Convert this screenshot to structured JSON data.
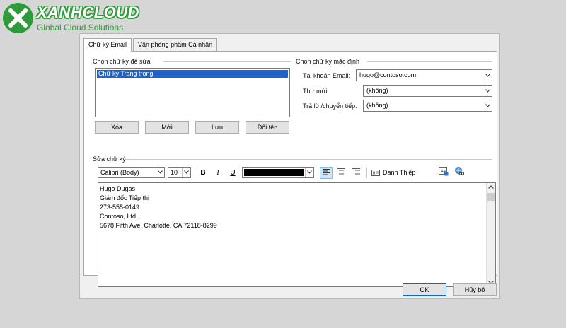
{
  "brand": {
    "name": "XANHCLOUD",
    "tagline": "Global Cloud Solutions",
    "color": "#2f9a3a"
  },
  "tabs": [
    {
      "label": "Chữ ký Email",
      "active": true
    },
    {
      "label": "Văn phòng phẩm Cá nhân",
      "active": false
    }
  ],
  "select_section": {
    "label": "Chọn chữ ký để sửa",
    "items": [
      "Chữ ký Trang trọng"
    ],
    "buttons": {
      "delete": "Xóa",
      "new": "Mới",
      "save": "Lưu",
      "rename": "Đổi tên"
    }
  },
  "default_section": {
    "label": "Chọn chữ ký mặc định",
    "account_label": "Tài khoản Email:",
    "account_value": "hugo@contoso.com",
    "new_messages_label": "Thư mới:",
    "new_messages_value": "(không)",
    "replies_label": "Trả lời/chuyển tiếp:",
    "replies_value": "(không)"
  },
  "edit_section": {
    "label": "Sửa chữ ký",
    "font": "Calibri (Body)",
    "size": "10",
    "bold": "B",
    "italic": "I",
    "underline": "U",
    "font_color": "#000000",
    "business_card_label": "Danh Thiếp",
    "lines": [
      "Hugo Dugas",
      "Giám đốc Tiếp thị",
      "273-555-0149",
      "Contoso, Ltd.",
      "5678 Fifth Ave, Charlotte, CA 72118-8299"
    ]
  },
  "footer": {
    "ok": "OK",
    "cancel": "Hủy bỏ"
  }
}
